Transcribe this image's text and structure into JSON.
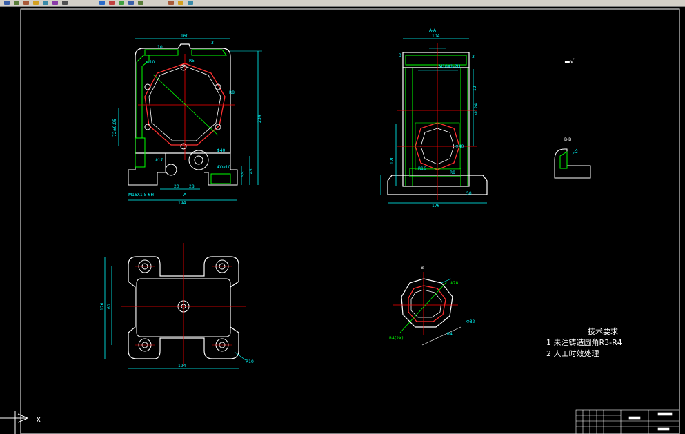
{
  "toolbar": {
    "icons": [
      "save-icon",
      "undo-icon",
      "redo-icon",
      "cut-icon",
      "copy-icon",
      "paste-icon",
      "pan-icon",
      "zoom-icon",
      "layer-icon",
      "properties-icon",
      "text-icon",
      "block-icon",
      "match-icon",
      "layer-state-icon",
      "color-icon"
    ]
  },
  "colors": {
    "background": "#000000",
    "outline": "#ffffff",
    "dimension": "#00ffff",
    "centerline": "#ff0000",
    "hatch": "#00ff00",
    "border": "#ffffff"
  },
  "front_view": {
    "width_dim": "160",
    "bottom_dim": "194",
    "height_dim": "234",
    "right_dim1": "45",
    "right_dim2": "55",
    "left_dim": "72±0.05",
    "note_r5": "R5",
    "note_r8": "R8",
    "note_phi10": "Φ10",
    "note_phi40": "Φ40",
    "note_phi17": "Φ17",
    "note_10": "10",
    "thread": "M16X1.5-6H",
    "dim_20": "20",
    "dim_28": "28",
    "dim_3": "3",
    "section_a": "A",
    "hole_note": "4XΦ10"
  },
  "side_view": {
    "section_label": "A-A",
    "width_dim": "104",
    "bottom_dim": "176",
    "bore_dim": "Φ124",
    "bore2_dim": "Φ40",
    "r8": "R8",
    "r16": "R16",
    "top_hole": "M10X1-7H",
    "dim_3a": "3",
    "dim_3b": "3",
    "right_dim": "12",
    "left_dim": "120",
    "base_dim": "50"
  },
  "plan_view": {
    "width_dim": "194",
    "height_dim": "176",
    "inner_dim": "60",
    "corner_note": "R10"
  },
  "detail_view": {
    "label": "B",
    "dim1": "Φ78",
    "dim2": "Φ82",
    "dim3": "R4",
    "dim4": "R4(2X)"
  },
  "detail_small": {
    "label": "B-B",
    "dim": "2"
  },
  "roughness_note": "▬√",
  "tech_req": {
    "title": "技术要求",
    "items": [
      "1   未注铸造圆角R3-R4",
      "2   人工时效处理"
    ]
  },
  "ucs": {
    "x_label": "X"
  }
}
